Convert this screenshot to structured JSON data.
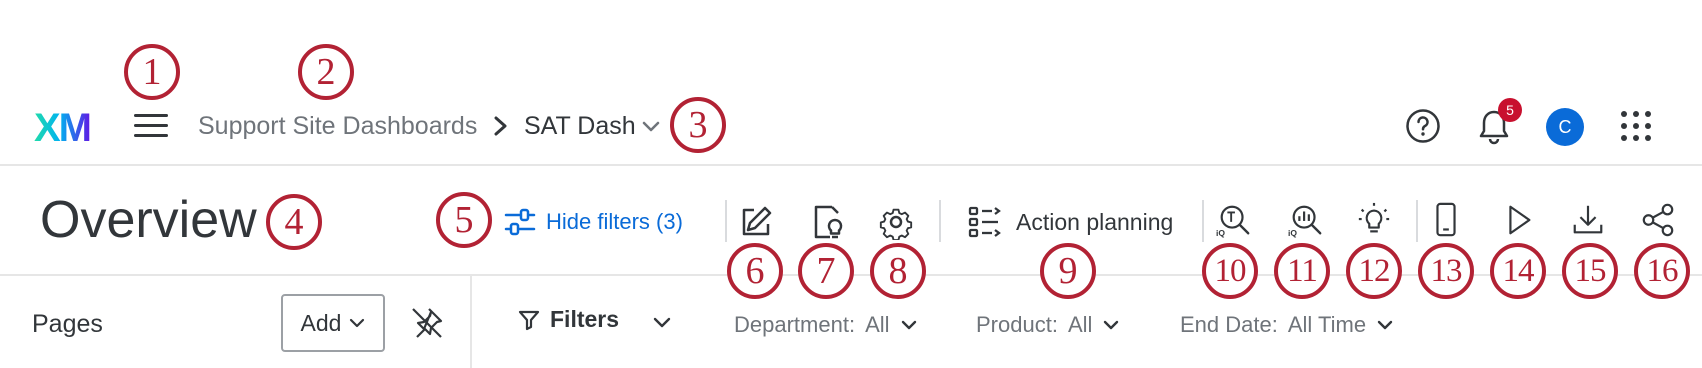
{
  "header": {
    "logo": "XM",
    "breadcrumb_parent": "Support Site Dashboards",
    "breadcrumb_current": "SAT Dash",
    "notification_count": "5",
    "avatar_initial": "C"
  },
  "toolbar": {
    "page_title": "Overview",
    "hide_filters_label": "Hide filters (3)",
    "action_planning_label": "Action planning"
  },
  "pages_panel": {
    "label": "Pages",
    "add_label": "Add"
  },
  "filters": {
    "label": "Filters",
    "chips": [
      {
        "name": "Department:",
        "value": "All"
      },
      {
        "name": "Product:",
        "value": "All"
      },
      {
        "name": "End Date:",
        "value": "All Time"
      }
    ]
  },
  "callouts": [
    "1",
    "2",
    "3",
    "4",
    "5",
    "6",
    "7",
    "8",
    "9",
    "10",
    "11",
    "12",
    "13",
    "14",
    "15",
    "16"
  ],
  "colors": {
    "accent": "#0a6bd8",
    "callout": "#b22234",
    "badge": "#c8102e",
    "text": "#32363a",
    "muted": "#6f747a"
  }
}
